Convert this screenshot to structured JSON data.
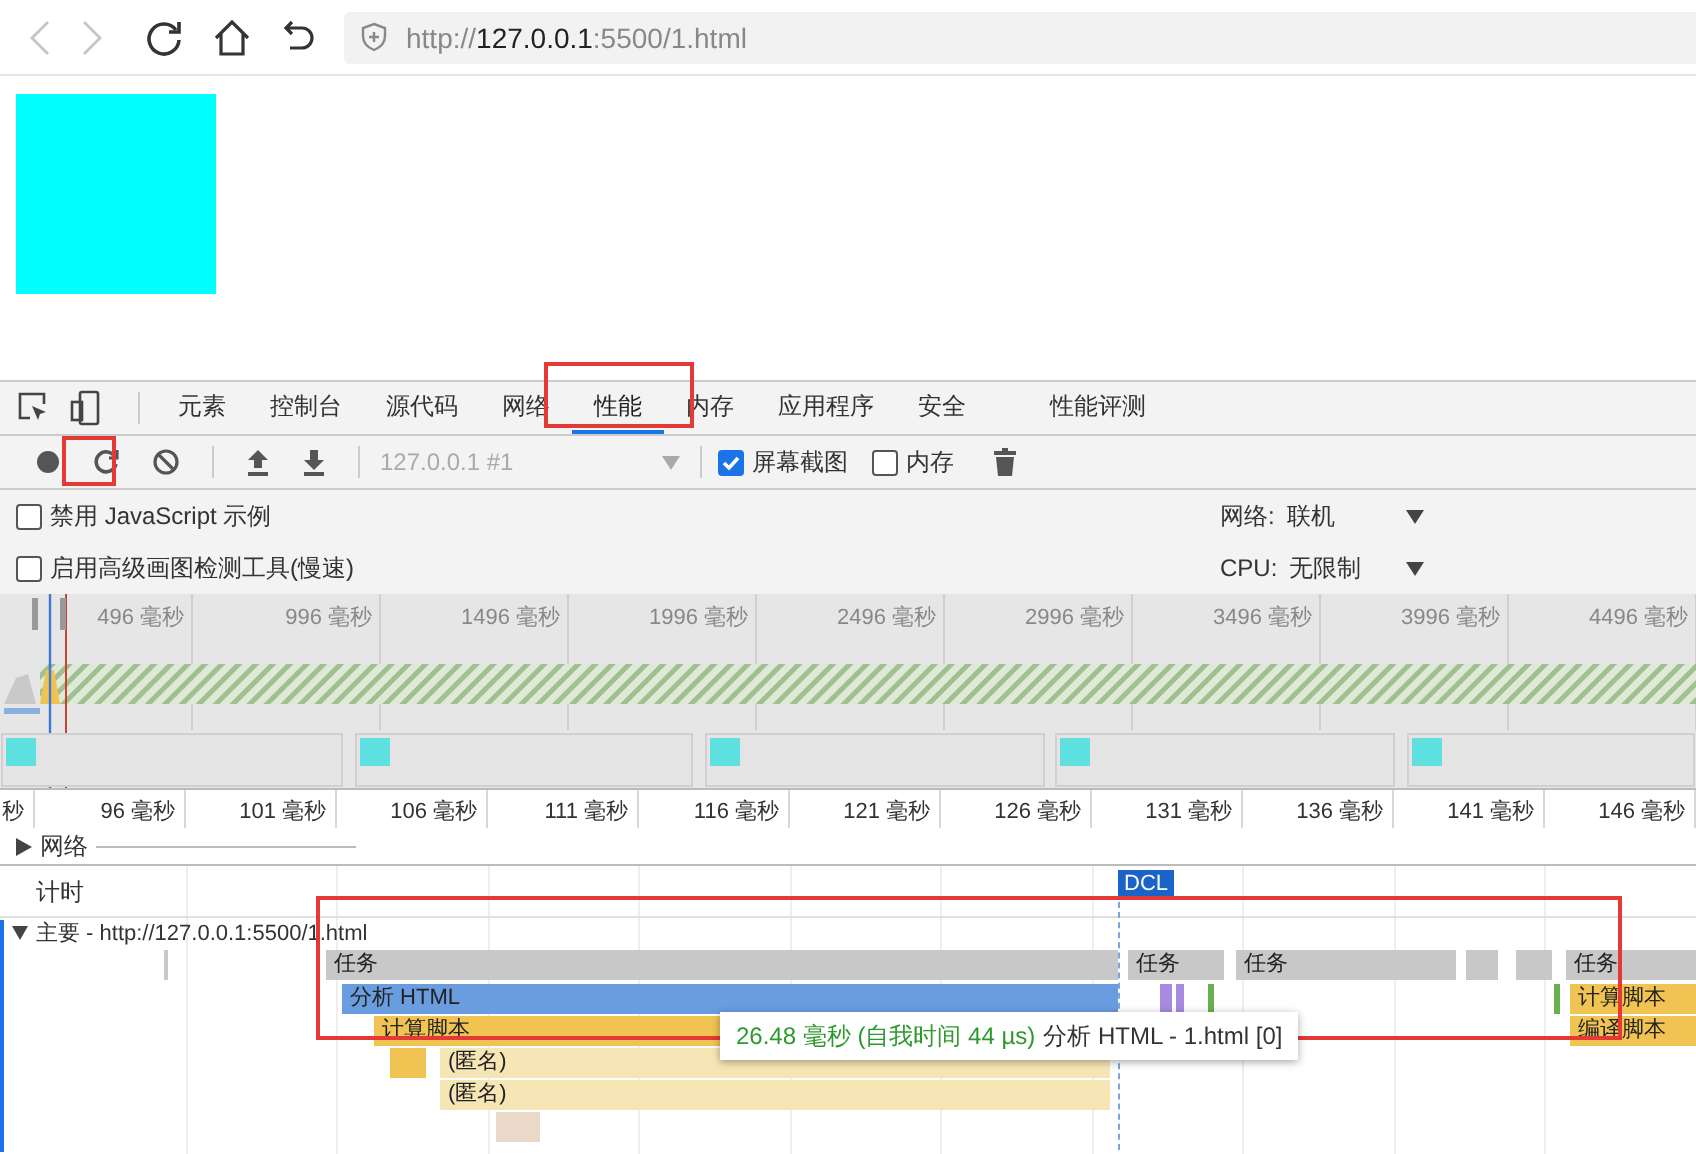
{
  "browser": {
    "url": {
      "scheme": "http://",
      "host": "127.0.0.1",
      "rest": ":5500/1.html"
    }
  },
  "devtools": {
    "tabs": [
      {
        "label": "元素",
        "selected": false
      },
      {
        "label": "控制台",
        "selected": false
      },
      {
        "label": "源代码",
        "selected": false
      },
      {
        "label": "网络",
        "selected": false
      },
      {
        "label": "性能",
        "selected": true
      },
      {
        "label": "内存",
        "selected": false
      },
      {
        "label": "应用程序",
        "selected": false
      },
      {
        "label": "安全",
        "selected": false
      },
      {
        "label": "性能评测",
        "selected": false
      }
    ],
    "toolbar": {
      "target": "127.0.0.1 #1",
      "checkboxes": [
        {
          "label": "屏幕截图",
          "checked": true
        },
        {
          "label": "内存",
          "checked": false
        }
      ]
    },
    "settings": [
      {
        "label": "禁用 JavaScript 示例",
        "checked": false,
        "select_label": "网络:",
        "select_value": "联机"
      },
      {
        "label": "启用高级画图检测工具(慢速)",
        "checked": false,
        "select_label": "CPU:",
        "select_value": "无限制"
      }
    ],
    "overview": {
      "ticks": [
        "496 毫秒",
        "996 毫秒",
        "1496 毫秒",
        "1996 毫秒",
        "2496 毫秒",
        "2996 毫秒",
        "3496 毫秒",
        "3996 毫秒",
        "4496 毫秒"
      ]
    },
    "flame_chart": {
      "ruler": [
        "秒",
        "96 毫秒",
        "101 毫秒",
        "106 毫秒",
        "111 毫秒",
        "116 毫秒",
        "121 毫秒",
        "126 毫秒",
        "131 毫秒",
        "136 毫秒",
        "141 毫秒",
        "146 毫秒"
      ],
      "network_track": {
        "label": "网络",
        "expanded": false
      },
      "timing_track": {
        "label": "计时",
        "marker": "DCL"
      },
      "main_track": {
        "label": "主要 - http://127.0.0.1:5500/1.html",
        "expanded": true,
        "bars": [
          {
            "label": "任务",
            "kind": "task"
          },
          {
            "label": "任务",
            "kind": "task"
          },
          {
            "label": "任务",
            "kind": "task"
          },
          {
            "label": "任务",
            "kind": "task"
          },
          {
            "label": "分析 HTML",
            "kind": "parse"
          },
          {
            "label": "计算脚本",
            "kind": "script"
          },
          {
            "label": "计算脚本",
            "kind": "script"
          },
          {
            "label": "编译脚本",
            "kind": "script"
          },
          {
            "label": "(匿名)",
            "kind": "anon"
          },
          {
            "label": "(匿名)",
            "kind": "anon"
          }
        ]
      },
      "tooltip": {
        "duration": "26.48 毫秒 (自我时间 44 µs)",
        "title": "分析 HTML - 1.html [0]"
      }
    }
  }
}
